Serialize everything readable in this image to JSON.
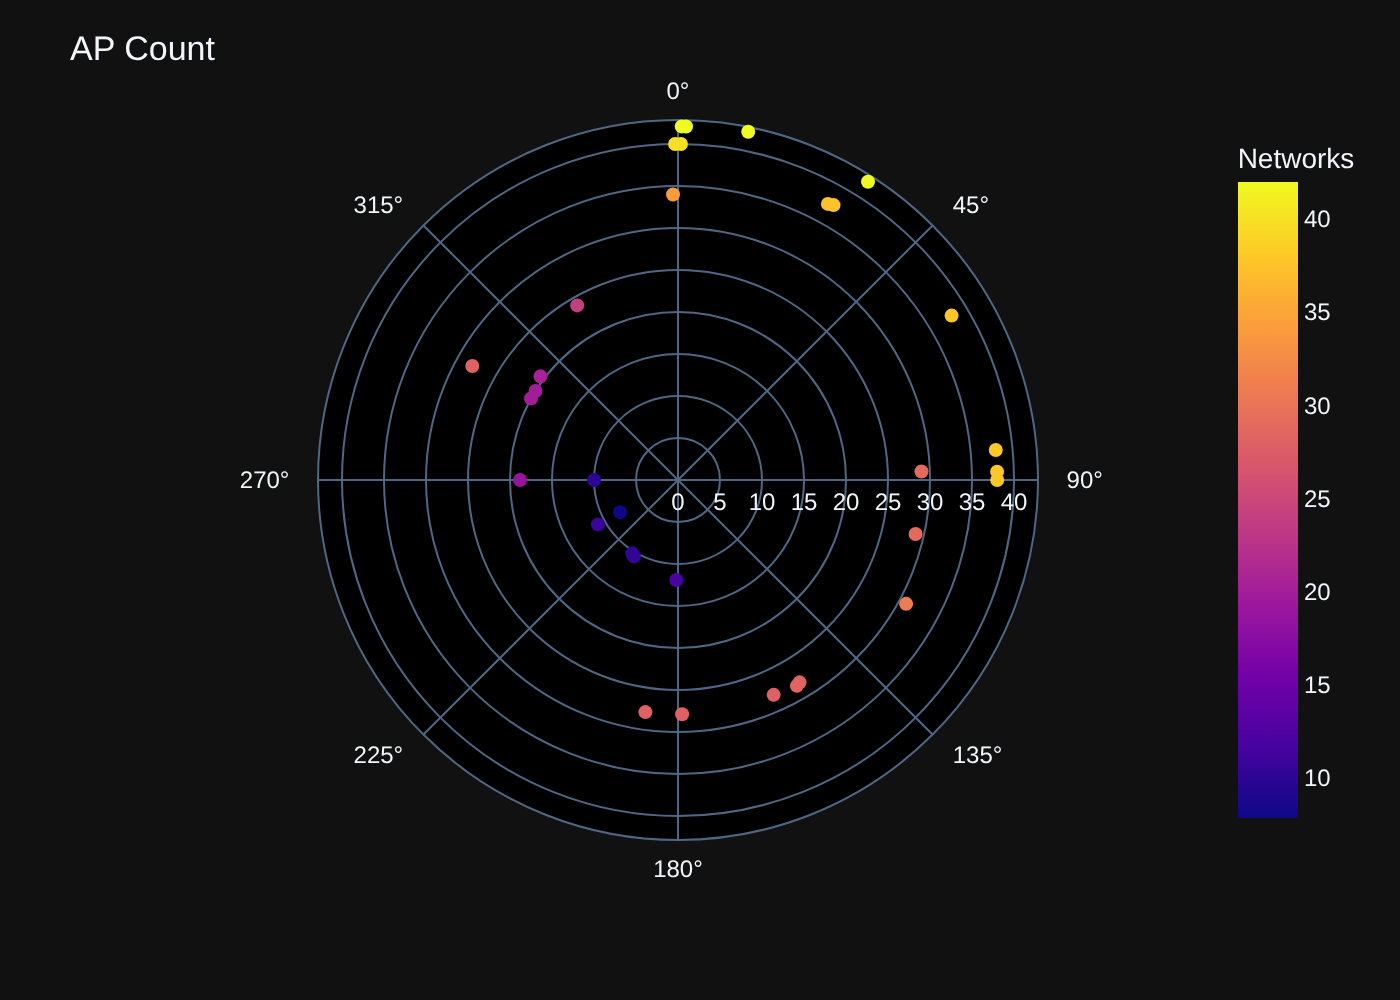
{
  "title": "AP Count",
  "polar_plot": {
    "angular_ticks": [
      "0°",
      "45°",
      "90°",
      "135°",
      "180°",
      "225°",
      "270°",
      "315°"
    ],
    "radial_ticks": [
      "0",
      "5",
      "10",
      "15",
      "20",
      "25",
      "30",
      "35",
      "40"
    ]
  },
  "colorbar": {
    "title": "Networks",
    "ticks": [
      "40",
      "35",
      "30",
      "25",
      "20",
      "15",
      "10"
    ]
  }
}
